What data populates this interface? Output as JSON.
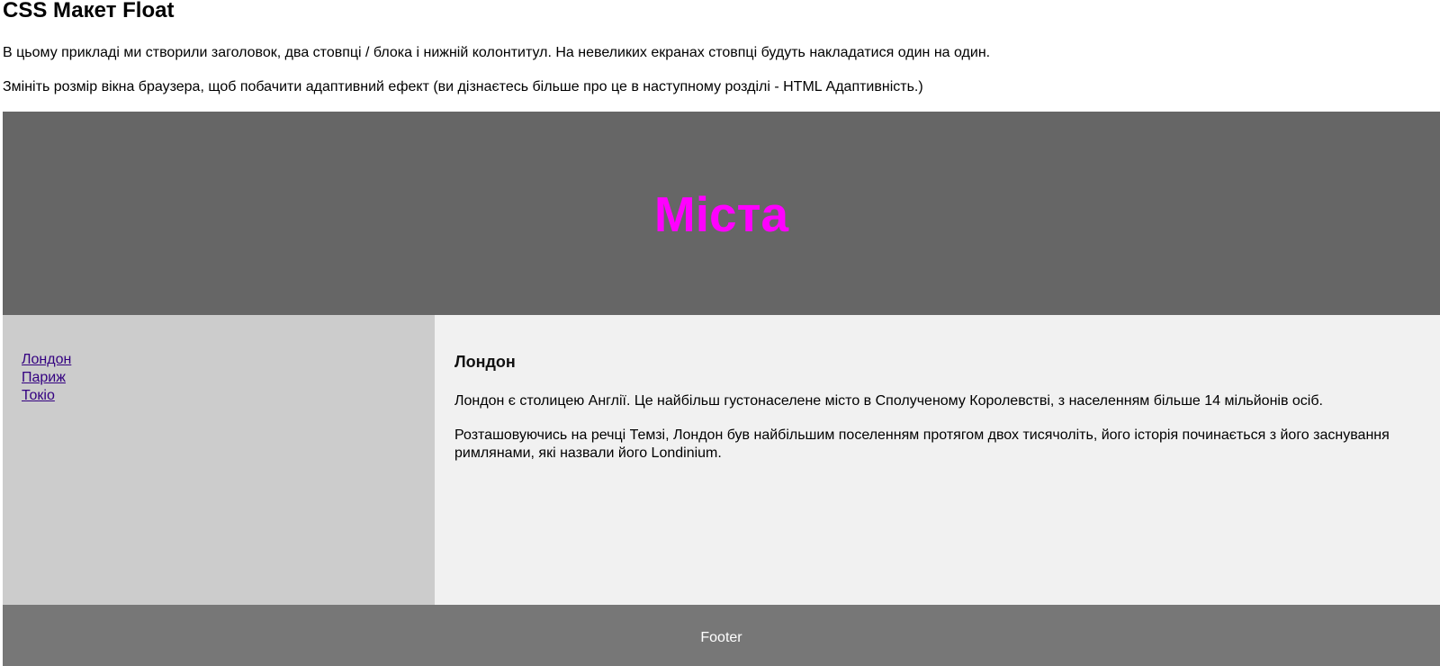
{
  "page": {
    "title": "CSS Макет Float",
    "intro": [
      "В цьому прикладі ми створили заголовок, два стовпці / блока і нижній колонтитул. На невеликих екранах стовпці будуть накладатися один на один.",
      "Змініть розмір вікна браузера, щоб побачити адаптивний ефект (ви дізнаєтесь більше про це в наступному розділі - HTML Адаптивність.)"
    ]
  },
  "header": {
    "title": "Міста"
  },
  "nav": {
    "items": [
      {
        "label": "Лондон"
      },
      {
        "label": "Париж"
      },
      {
        "label": "Токіо"
      }
    ]
  },
  "article": {
    "title": "Лондон",
    "paragraphs": [
      "Лондон є столицею Англії. Це найбільш густонаселене місто в Сполученому Королевстві, з населенням більше 14 мільйонів осіб.",
      "Розташовуючись на речці Темзі, Лондон був найбільшим поселенням протягом двох тисячоліть, його історія починається з його заснування римлянами, які назвали його Londinium."
    ]
  },
  "footer": {
    "text": "Footer"
  },
  "colors": {
    "header_bg": "#666666",
    "header_title": "#ff00ff",
    "nav_bg": "#cccccc",
    "article_bg": "#f1f1f1",
    "footer_bg": "#777777",
    "link": "#330080"
  }
}
